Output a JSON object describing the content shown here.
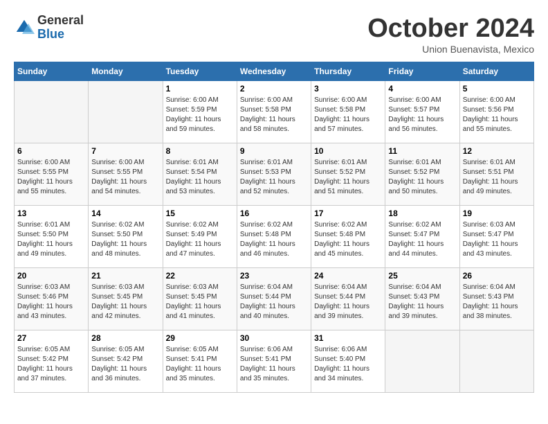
{
  "logo": {
    "general": "General",
    "blue": "Blue"
  },
  "title": "October 2024",
  "subtitle": "Union Buenavista, Mexico",
  "days_header": [
    "Sunday",
    "Monday",
    "Tuesday",
    "Wednesday",
    "Thursday",
    "Friday",
    "Saturday"
  ],
  "weeks": [
    [
      {
        "day": "",
        "info": ""
      },
      {
        "day": "",
        "info": ""
      },
      {
        "day": "1",
        "info": "Sunrise: 6:00 AM\nSunset: 5:59 PM\nDaylight: 11 hours and 59 minutes."
      },
      {
        "day": "2",
        "info": "Sunrise: 6:00 AM\nSunset: 5:58 PM\nDaylight: 11 hours and 58 minutes."
      },
      {
        "day": "3",
        "info": "Sunrise: 6:00 AM\nSunset: 5:58 PM\nDaylight: 11 hours and 57 minutes."
      },
      {
        "day": "4",
        "info": "Sunrise: 6:00 AM\nSunset: 5:57 PM\nDaylight: 11 hours and 56 minutes."
      },
      {
        "day": "5",
        "info": "Sunrise: 6:00 AM\nSunset: 5:56 PM\nDaylight: 11 hours and 55 minutes."
      }
    ],
    [
      {
        "day": "6",
        "info": "Sunrise: 6:00 AM\nSunset: 5:55 PM\nDaylight: 11 hours and 55 minutes."
      },
      {
        "day": "7",
        "info": "Sunrise: 6:00 AM\nSunset: 5:55 PM\nDaylight: 11 hours and 54 minutes."
      },
      {
        "day": "8",
        "info": "Sunrise: 6:01 AM\nSunset: 5:54 PM\nDaylight: 11 hours and 53 minutes."
      },
      {
        "day": "9",
        "info": "Sunrise: 6:01 AM\nSunset: 5:53 PM\nDaylight: 11 hours and 52 minutes."
      },
      {
        "day": "10",
        "info": "Sunrise: 6:01 AM\nSunset: 5:52 PM\nDaylight: 11 hours and 51 minutes."
      },
      {
        "day": "11",
        "info": "Sunrise: 6:01 AM\nSunset: 5:52 PM\nDaylight: 11 hours and 50 minutes."
      },
      {
        "day": "12",
        "info": "Sunrise: 6:01 AM\nSunset: 5:51 PM\nDaylight: 11 hours and 49 minutes."
      }
    ],
    [
      {
        "day": "13",
        "info": "Sunrise: 6:01 AM\nSunset: 5:50 PM\nDaylight: 11 hours and 49 minutes."
      },
      {
        "day": "14",
        "info": "Sunrise: 6:02 AM\nSunset: 5:50 PM\nDaylight: 11 hours and 48 minutes."
      },
      {
        "day": "15",
        "info": "Sunrise: 6:02 AM\nSunset: 5:49 PM\nDaylight: 11 hours and 47 minutes."
      },
      {
        "day": "16",
        "info": "Sunrise: 6:02 AM\nSunset: 5:48 PM\nDaylight: 11 hours and 46 minutes."
      },
      {
        "day": "17",
        "info": "Sunrise: 6:02 AM\nSunset: 5:48 PM\nDaylight: 11 hours and 45 minutes."
      },
      {
        "day": "18",
        "info": "Sunrise: 6:02 AM\nSunset: 5:47 PM\nDaylight: 11 hours and 44 minutes."
      },
      {
        "day": "19",
        "info": "Sunrise: 6:03 AM\nSunset: 5:47 PM\nDaylight: 11 hours and 43 minutes."
      }
    ],
    [
      {
        "day": "20",
        "info": "Sunrise: 6:03 AM\nSunset: 5:46 PM\nDaylight: 11 hours and 43 minutes."
      },
      {
        "day": "21",
        "info": "Sunrise: 6:03 AM\nSunset: 5:45 PM\nDaylight: 11 hours and 42 minutes."
      },
      {
        "day": "22",
        "info": "Sunrise: 6:03 AM\nSunset: 5:45 PM\nDaylight: 11 hours and 41 minutes."
      },
      {
        "day": "23",
        "info": "Sunrise: 6:04 AM\nSunset: 5:44 PM\nDaylight: 11 hours and 40 minutes."
      },
      {
        "day": "24",
        "info": "Sunrise: 6:04 AM\nSunset: 5:44 PM\nDaylight: 11 hours and 39 minutes."
      },
      {
        "day": "25",
        "info": "Sunrise: 6:04 AM\nSunset: 5:43 PM\nDaylight: 11 hours and 39 minutes."
      },
      {
        "day": "26",
        "info": "Sunrise: 6:04 AM\nSunset: 5:43 PM\nDaylight: 11 hours and 38 minutes."
      }
    ],
    [
      {
        "day": "27",
        "info": "Sunrise: 6:05 AM\nSunset: 5:42 PM\nDaylight: 11 hours and 37 minutes."
      },
      {
        "day": "28",
        "info": "Sunrise: 6:05 AM\nSunset: 5:42 PM\nDaylight: 11 hours and 36 minutes."
      },
      {
        "day": "29",
        "info": "Sunrise: 6:05 AM\nSunset: 5:41 PM\nDaylight: 11 hours and 35 minutes."
      },
      {
        "day": "30",
        "info": "Sunrise: 6:06 AM\nSunset: 5:41 PM\nDaylight: 11 hours and 35 minutes."
      },
      {
        "day": "31",
        "info": "Sunrise: 6:06 AM\nSunset: 5:40 PM\nDaylight: 11 hours and 34 minutes."
      },
      {
        "day": "",
        "info": ""
      },
      {
        "day": "",
        "info": ""
      }
    ]
  ]
}
